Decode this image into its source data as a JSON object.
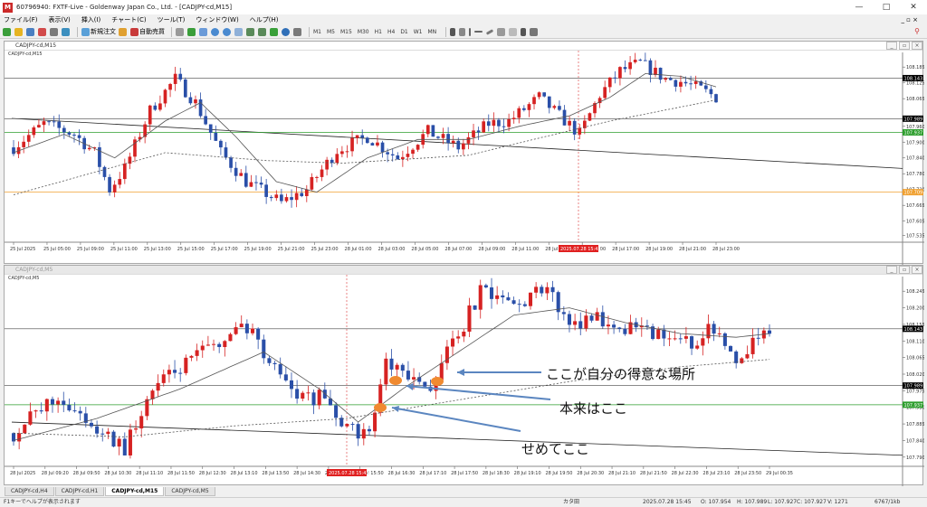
{
  "window": {
    "title": "60796940: FXTF-Live - Goldenway Japan Co., Ltd. - [CADJPY-cd,M15]",
    "min": "—",
    "max": "□",
    "close": "✕"
  },
  "menu": [
    "ファイル(F)",
    "表示(V)",
    "挿入(I)",
    "チャート(C)",
    "ツール(T)",
    "ウィンドウ(W)",
    "ヘルプ(H)"
  ],
  "menu_right": "_ ▫ ×",
  "toolbar": {
    "new_order": "新規注文",
    "auto_trade": "自動売買",
    "timeframes": [
      "M1",
      "M5",
      "M15",
      "M30",
      "H1",
      "H4",
      "D1",
      "W1",
      "MN"
    ]
  },
  "chart1": {
    "title": "CADJPY-cd,M15",
    "symbol": "CADJPY-cd,M15",
    "price_labels": [
      {
        "v": 108.185,
        "t": "108.185"
      },
      {
        "v": 108.125,
        "t": "108.125"
      },
      {
        "v": 108.065,
        "t": "108.065"
      },
      {
        "v": 107.96,
        "t": "107.960"
      },
      {
        "v": 107.9,
        "t": "107.900"
      },
      {
        "v": 107.84,
        "t": "107.840"
      },
      {
        "v": 107.78,
        "t": "107.780"
      },
      {
        "v": 107.72,
        "t": "107.720"
      },
      {
        "v": 107.66,
        "t": "107.665"
      },
      {
        "v": 107.6,
        "t": "107.605"
      },
      {
        "v": 107.545,
        "t": "107.535"
      }
    ],
    "hl_labels": [
      {
        "v": 108.143,
        "t": "108.143",
        "c": "#000000"
      },
      {
        "v": 107.989,
        "t": "107.989",
        "c": "#000000"
      },
      {
        "v": 107.937,
        "t": "107.937",
        "c": "#2e9e2e"
      },
      {
        "v": 107.71,
        "t": "107.709",
        "c": "#f0a030"
      }
    ],
    "time_labels": [
      "25 Jul 2025",
      "25 Jul 05:00",
      "25 Jul 09:00",
      "25 Jul 11:00",
      "25 Jul 13:00",
      "25 Jul 15:00",
      "25 Jul 17:00",
      "25 Jul 19:00",
      "25 Jul 21:00",
      "25 Jul 23:00",
      "28 Jul 01:00",
      "28 Jul 03:00",
      "28 Jul 05:00",
      "28 Jul 07:00",
      "28 Jul 09:00",
      "28 Jul 11:00",
      "28 Jul 13:00",
      "28 Jul 15:00",
      "28 Jul 17:00",
      "28 Jul 19:00",
      "28 Jul 21:00",
      "28 Jul 23:00"
    ],
    "cursor_label": "2025.07.28 15:45"
  },
  "chart2": {
    "title": "CADJPY-cd,M5",
    "symbol": "CADJPY-cd,M5",
    "price_labels": [
      {
        "v": 108.245,
        "t": "108.245"
      },
      {
        "v": 108.2,
        "t": "108.200"
      },
      {
        "v": 108.155,
        "t": "108.155"
      },
      {
        "v": 108.11,
        "t": "108.110"
      },
      {
        "v": 108.065,
        "t": "108.065"
      },
      {
        "v": 108.02,
        "t": "108.020"
      },
      {
        "v": 107.975,
        "t": "107.975"
      },
      {
        "v": 107.93,
        "t": "107.930"
      },
      {
        "v": 107.885,
        "t": "107.885"
      },
      {
        "v": 107.84,
        "t": "107.840"
      },
      {
        "v": 107.795,
        "t": "107.790"
      }
    ],
    "hl_labels": [
      {
        "v": 108.143,
        "t": "108.143",
        "c": "#000000"
      },
      {
        "v": 107.989,
        "t": "107.989",
        "c": "#000000"
      },
      {
        "v": 107.937,
        "t": "107.937",
        "c": "#2e9e2e"
      }
    ],
    "time_labels": [
      "28 Jul 2025",
      "28 Jul 09:20",
      "28 Jul 09:50",
      "28 Jul 10:30",
      "28 Jul 11:10",
      "28 Jul 11:50",
      "28 Jul 12:30",
      "28 Jul 13:10",
      "28 Jul 13:50",
      "28 Jul 14:30",
      "28 Jul 15:10",
      "28 Jul 15:50",
      "28 Jul 16:30",
      "28 Jul 17:10",
      "28 Jul 17:50",
      "28 Jul 18:30",
      "28 Jul 19:10",
      "28 Jul 19:50",
      "28 Jul 20:30",
      "28 Jul 21:10",
      "28 Jul 21:50",
      "28 Jul 22:30",
      "28 Jul 23:10",
      "28 Jul 23:50",
      "29 Jul 00:35"
    ],
    "cursor_label": "2025.07.28 15:45",
    "annotations": [
      "ここが自分の得意な場所",
      "本来はここ",
      "せめてここ"
    ]
  },
  "tabs": [
    "CADJPY-cd,H4",
    "CADJPY-cd,H1",
    "CADJPY-cd,M15",
    "CADJPY-cd,M5"
  ],
  "active_tab": 2,
  "status": {
    "help": "F1キーでヘルプが表示されます",
    "profile": "カタ田",
    "datetime": "2025.07.28 15:45",
    "open": "O: 107.954",
    "high": "H: 107.989",
    "low": "L: 107.927",
    "close": "C: 107.927",
    "volume": "V: 1271",
    "bars": "6767/1kb"
  },
  "chart_data": [
    {
      "type": "candlestick",
      "title": "CADJPY-cd,M15",
      "path": [
        [
          0,
          107.88
        ],
        [
          6,
          107.97
        ],
        [
          12,
          107.93
        ],
        [
          16,
          107.86
        ],
        [
          19,
          107.72
        ],
        [
          22,
          107.8
        ],
        [
          27,
          108.02
        ],
        [
          32,
          108.14
        ],
        [
          36,
          108.05
        ],
        [
          41,
          107.86
        ],
        [
          46,
          107.75
        ],
        [
          53,
          107.67
        ],
        [
          58,
          107.72
        ],
        [
          64,
          107.87
        ],
        [
          70,
          107.92
        ],
        [
          76,
          107.84
        ],
        [
          82,
          107.94
        ],
        [
          88,
          107.88
        ],
        [
          94,
          107.97
        ],
        [
          98,
          107.98
        ],
        [
          104,
          108.07
        ],
        [
          108,
          108.0
        ],
        [
          112,
          107.93
        ],
        [
          116,
          108.08
        ],
        [
          120,
          108.17
        ],
        [
          124,
          108.2
        ],
        [
          129,
          108.14
        ],
        [
          132,
          108.13
        ],
        [
          136,
          108.1
        ],
        [
          139,
          108.07
        ]
      ],
      "ma_fast": [
        [
          0,
          107.86
        ],
        [
          10,
          107.93
        ],
        [
          20,
          107.84
        ],
        [
          30,
          107.98
        ],
        [
          37,
          108.05
        ],
        [
          44,
          107.92
        ],
        [
          52,
          107.75
        ],
        [
          60,
          107.71
        ],
        [
          70,
          107.84
        ],
        [
          80,
          107.91
        ],
        [
          90,
          107.91
        ],
        [
          100,
          107.96
        ],
        [
          110,
          108.0
        ],
        [
          118,
          108.07
        ],
        [
          125,
          108.16
        ],
        [
          132,
          108.15
        ],
        [
          139,
          108.11
        ]
      ],
      "ma_slow": [
        [
          0,
          107.7
        ],
        [
          30,
          107.86
        ],
        [
          50,
          107.83
        ],
        [
          65,
          107.82
        ],
        [
          90,
          107.85
        ],
        [
          105,
          107.92
        ],
        [
          118,
          107.98
        ],
        [
          139,
          108.06
        ]
      ],
      "lines": {
        "trend_black": [
          [
            0,
            107.99
          ],
          [
            139,
            107.8
          ]
        ],
        "h_green": 107.937,
        "h_orange": 107.71,
        "h_black": [
          108.143,
          107.989
        ]
      }
    },
    {
      "type": "candlestick",
      "title": "CADJPY-cd,M5",
      "path": [
        [
          0,
          107.86
        ],
        [
          8,
          107.96
        ],
        [
          15,
          107.87
        ],
        [
          20,
          107.82
        ],
        [
          25,
          107.98
        ],
        [
          35,
          108.09
        ],
        [
          42,
          108.15
        ],
        [
          48,
          108.02
        ],
        [
          52,
          107.95
        ],
        [
          56,
          107.96
        ],
        [
          60,
          107.87
        ],
        [
          64,
          107.86
        ],
        [
          67,
          108.05
        ],
        [
          71,
          108.0
        ],
        [
          75,
          107.99
        ],
        [
          80,
          108.13
        ],
        [
          84,
          108.24
        ],
        [
          90,
          108.21
        ],
        [
          96,
          108.25
        ],
        [
          100,
          108.15
        ],
        [
          104,
          108.18
        ],
        [
          110,
          108.15
        ],
        [
          116,
          108.12
        ],
        [
          122,
          108.1
        ],
        [
          126,
          108.15
        ],
        [
          130,
          108.06
        ],
        [
          133,
          108.11
        ],
        [
          136,
          108.14
        ]
      ],
      "ma_fast": [
        [
          0,
          107.84
        ],
        [
          15,
          107.9
        ],
        [
          30,
          107.98
        ],
        [
          45,
          108.08
        ],
        [
          55,
          107.98
        ],
        [
          62,
          107.89
        ],
        [
          70,
          107.98
        ],
        [
          80,
          108.08
        ],
        [
          90,
          108.18
        ],
        [
          100,
          108.2
        ],
        [
          110,
          108.16
        ],
        [
          120,
          108.13
        ],
        [
          130,
          108.12
        ],
        [
          136,
          108.13
        ]
      ],
      "ma_slow": [
        [
          0,
          107.86
        ],
        [
          20,
          107.85
        ],
        [
          40,
          107.88
        ],
        [
          60,
          107.9
        ],
        [
          80,
          107.95
        ],
        [
          100,
          108.0
        ],
        [
          120,
          108.04
        ],
        [
          136,
          108.06
        ]
      ],
      "lines": {
        "trend_black": [
          [
            0,
            107.89
          ],
          [
            136,
            107.8
          ]
        ],
        "h_green": 107.937,
        "h_black": [
          108.143,
          107.989
        ]
      }
    }
  ]
}
